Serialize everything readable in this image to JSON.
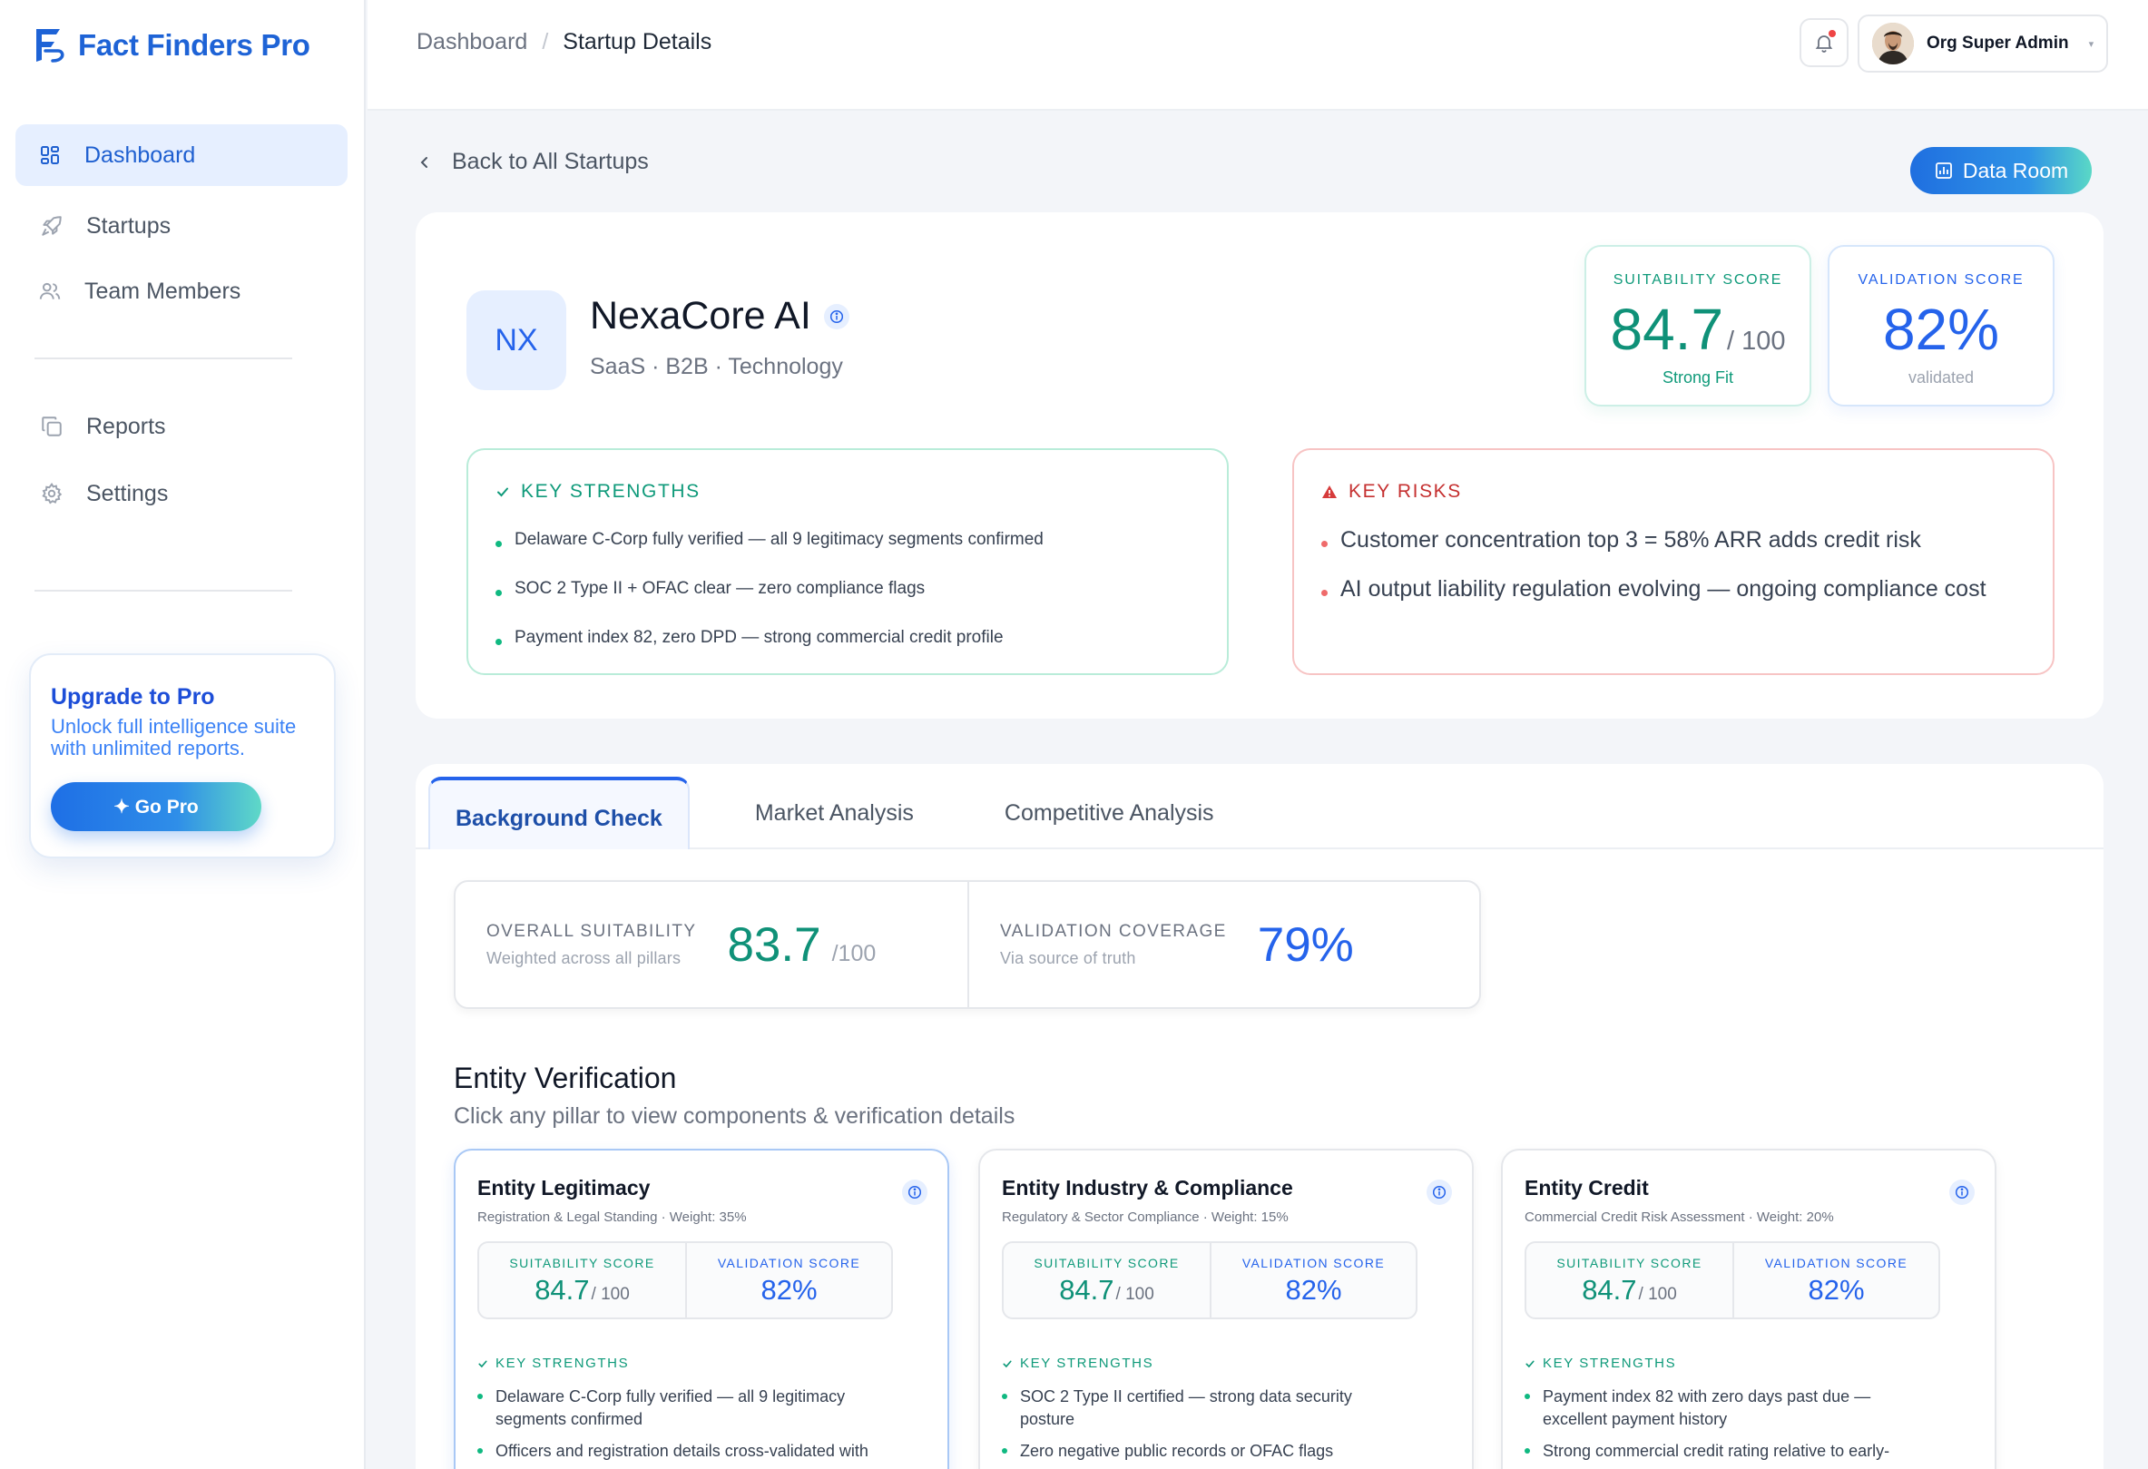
{
  "app": {
    "name": "Fact Finders Pro"
  },
  "sidebar": {
    "items": [
      {
        "label": "Dashboard",
        "icon": "grid-icon",
        "active": true
      },
      {
        "label": "Startups",
        "icon": "rocket-icon",
        "active": false
      },
      {
        "label": "Team Members",
        "icon": "users-icon",
        "active": false
      },
      {
        "label": "Reports",
        "icon": "copy-icon",
        "active": false
      },
      {
        "label": "Settings",
        "icon": "gear-icon",
        "active": false
      }
    ],
    "upgrade": {
      "title": "Upgrade to Pro",
      "description": "Unlock full intelligence suite with unlimited reports.",
      "button": "✦ Go Pro"
    }
  },
  "header": {
    "breadcrumb": [
      "Dashboard",
      "/",
      "Startup Details"
    ],
    "user_name": "Org Super Admin",
    "caret": "▾"
  },
  "page": {
    "back_label": "Back to All Startups",
    "data_room_label": "Data Room"
  },
  "company": {
    "initials": "NX",
    "name": "NexaCore AI",
    "tags": "SaaS · B2B · Technology",
    "suitability": {
      "label": "SUITABILITY SCORE",
      "value": "84.7",
      "suffix": "/ 100",
      "sub": "Strong Fit"
    },
    "validation": {
      "label": "VALIDATION SCORE",
      "value": "82%",
      "sub": "validated"
    },
    "strengths": {
      "title": "KEY STRENGTHS",
      "items": [
        "Delaware C-Corp fully verified — all 9 legitimacy segments confirmed",
        "SOC 2 Type II + OFAC clear — zero compliance flags",
        "Payment index 82, zero DPD — strong commercial credit profile"
      ]
    },
    "risks": {
      "title": "KEY RISKS",
      "items": [
        "Customer concentration top 3 = 58% ARR adds credit risk",
        "AI output liability regulation evolving — ongoing compliance cost"
      ]
    }
  },
  "tabs": [
    {
      "label": "Background Check",
      "active": true
    },
    {
      "label": "Market Analysis",
      "active": false
    },
    {
      "label": "Competitive Analysis",
      "active": false
    }
  ],
  "overview": {
    "suitability": {
      "label": "OVERALL SUITABILITY",
      "sub": "Weighted across all pillars",
      "value": "83.7",
      "suffix": "/100"
    },
    "coverage": {
      "label": "VALIDATION COVERAGE",
      "sub": "Via source of truth",
      "value": "79%"
    }
  },
  "entity_verification": {
    "title": "Entity Verification",
    "subtitle": "Click any pillar to view components & verification details",
    "pillars": [
      {
        "title": "Entity Legitimacy",
        "subtitle": "Registration & Legal Standing · Weight: 35%",
        "suitability_label": "SUITABILITY SCORE",
        "suitability_value": "84.7",
        "suitability_suffix": "/ 100",
        "validation_label": "VALIDATION SCORE",
        "validation_value": "82%",
        "strengths_title": "KEY STRENGTHS",
        "strengths": [
          "Delaware C-Corp fully verified — all 9 legitimacy segments confirmed",
          "Officers and registration details cross-validated with"
        ]
      },
      {
        "title": "Entity Industry & Compliance",
        "subtitle": "Regulatory & Sector Compliance · Weight: 15%",
        "suitability_label": "SUITABILITY SCORE",
        "suitability_value": "84.7",
        "suitability_suffix": "/ 100",
        "validation_label": "VALIDATION SCORE",
        "validation_value": "82%",
        "strengths_title": "KEY STRENGTHS",
        "strengths": [
          "SOC 2 Type II certified — strong data security posture",
          "Zero negative public records or OFAC flags"
        ]
      },
      {
        "title": "Entity Credit",
        "subtitle": "Commercial Credit Risk Assessment · Weight: 20%",
        "suitability_label": "SUITABILITY SCORE",
        "suitability_value": "84.7",
        "suitability_suffix": "/ 100",
        "validation_label": "VALIDATION SCORE",
        "validation_value": "82%",
        "strengths_title": "KEY STRENGTHS",
        "strengths": [
          "Payment index 82 with zero days past due — excellent payment history",
          "Strong commercial credit rating relative to early-"
        ]
      }
    ]
  },
  "colors": {
    "brand": "#1e63d6",
    "teal": "#0f9178",
    "blue": "#2563eb",
    "risk": "#c53030"
  }
}
